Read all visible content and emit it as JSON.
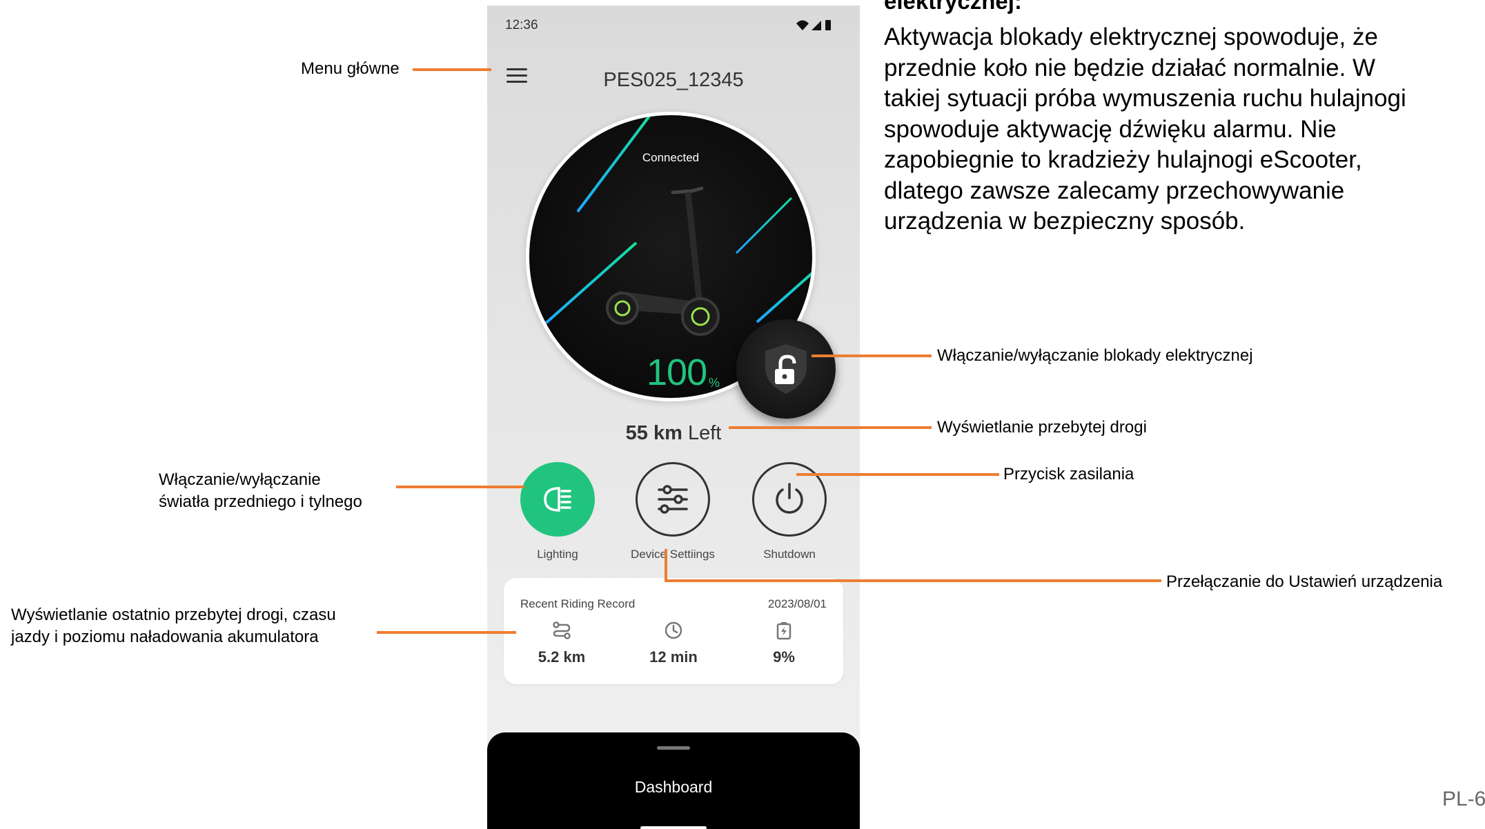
{
  "phone": {
    "status": {
      "time": "12:36"
    },
    "device_name": "PES025_12345",
    "connection_status": "Connected",
    "battery": {
      "value": "100",
      "unit": "%"
    },
    "range": {
      "value": "55 km",
      "suffix": "Left"
    },
    "controls": {
      "lighting_label": "Lighting",
      "settings_label": "Device Settiings",
      "shutdown_label": "Shutdown"
    },
    "recent_record": {
      "title": "Recent Riding Record",
      "date": "2023/08/01",
      "distance": "5.2 km",
      "time": "12 min",
      "battery_used": "9%"
    },
    "bottom_nav": {
      "tab_label": "Dashboard"
    }
  },
  "annotations": {
    "main_menu": "Menu główne",
    "electric_lock": "Włączanie/wyłączanie blokady elektrycznej",
    "range_display": "Wyświetlanie przebytej drogi",
    "power_button": "Przycisk zasilania",
    "lights_line1": "Włączanie/wyłączanie",
    "lights_line2": "światła przedniego i tylnego",
    "device_settings": "Przełączanie do Ustawień urządzenia",
    "recent_line1": "Wyświetlanie ostatnio przebytej drogi, czasu",
    "recent_line2": "jazdy i poziomu naładowania akumulatora"
  },
  "notice": {
    "heading": "elektrycznej:",
    "body": "Aktywacja blokady elektrycznej spowoduje, że przednie koło nie będzie działać normalnie. W takiej sytuacji próba wymuszenia ruchu hulajnogi spowoduje aktywację dźwięku alarmu. Nie zapobiegnie to kradzieży hulajnogi eScooter, dlatego zawsze zalecamy przechowywanie urządzenia w bezpieczny sposób."
  },
  "page_number": "PL-6",
  "colors": {
    "accent_green": "#21c47f",
    "leader_orange": "#ed7d31",
    "dial_dark": "#0b0b0b"
  }
}
